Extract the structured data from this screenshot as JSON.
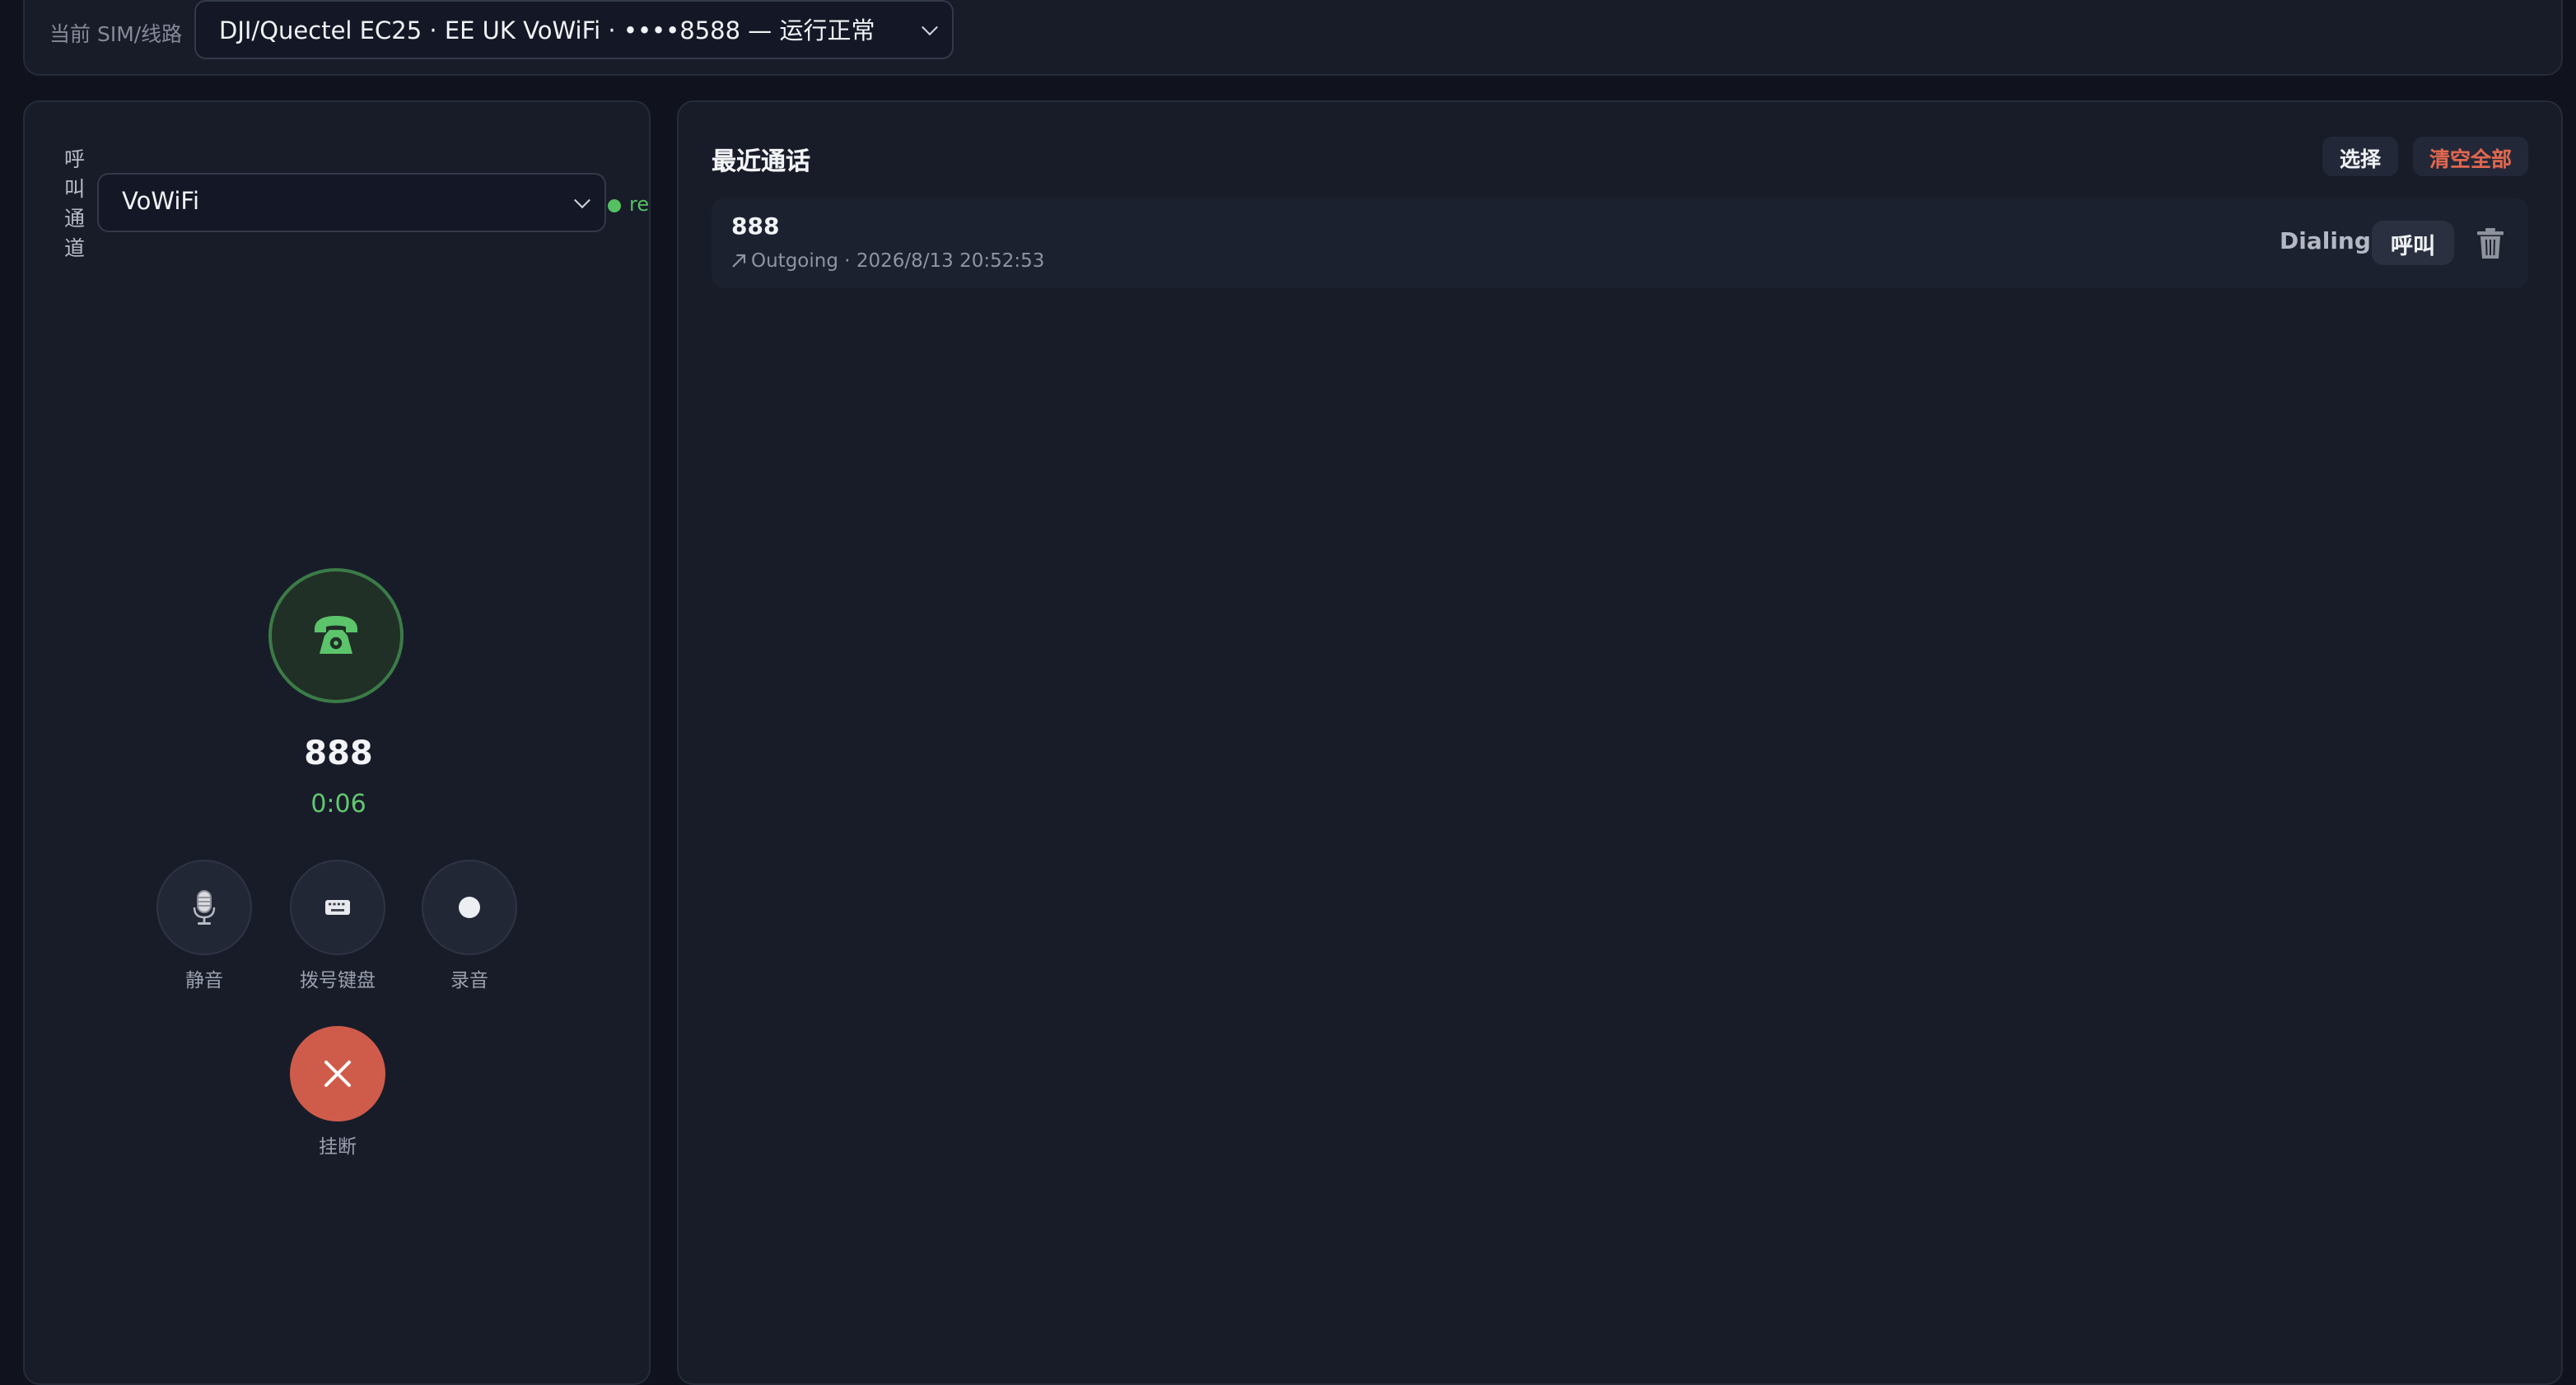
{
  "topbar": {
    "sim_label": "当前 SIM/线路",
    "sim_value": "DJI/Quectel EC25 · EE UK VoWiFi · ••••8588 — 运行正常"
  },
  "dialer": {
    "channel_label": "呼叫通道",
    "channel_value": "VoWiFi",
    "channel_status_text": "re",
    "callee": "888",
    "timer": "0:06",
    "controls": {
      "mute": {
        "label": "静音",
        "icon": "microphone-icon"
      },
      "keypad": {
        "label": "拨号键盘",
        "icon": "keyboard-icon"
      },
      "record": {
        "label": "录音",
        "icon": "record-dot-icon"
      }
    },
    "hangup_label": "挂断",
    "status_color": "#54c062",
    "hangup_color": "#cf5c4a"
  },
  "recent": {
    "title": "最近通话",
    "select_label": "选择",
    "clear_label": "清空全部",
    "calls": [
      {
        "number": "888",
        "direction_icon": "outgoing-arrow-icon",
        "meta": "Outgoing · 2026/8/13 20:52:53",
        "status": "Dialing",
        "call_label": "呼叫"
      }
    ]
  }
}
